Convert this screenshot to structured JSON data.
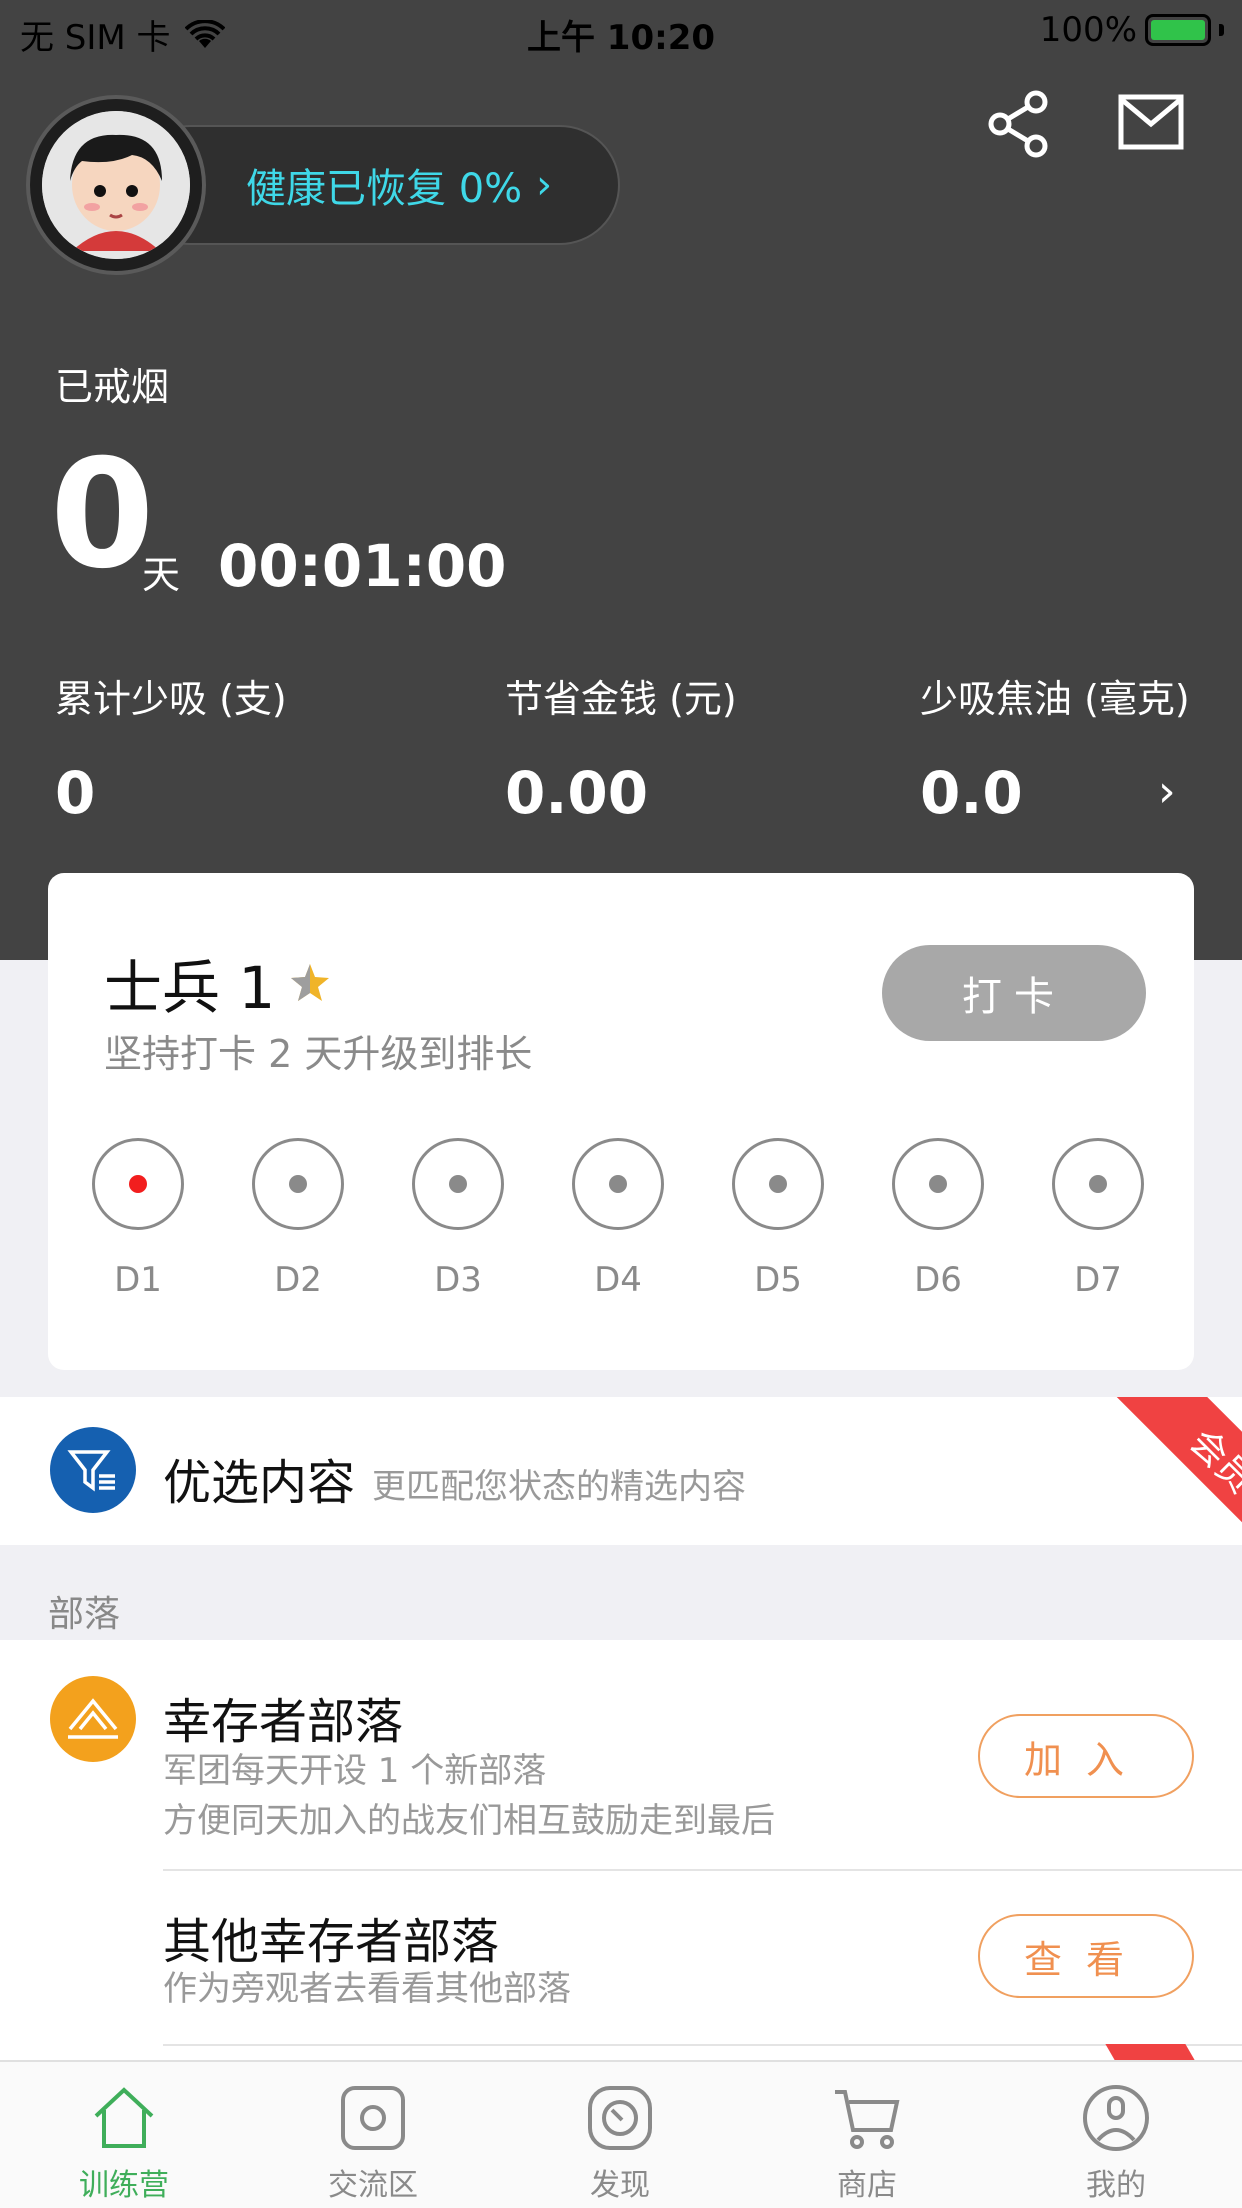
{
  "status_bar": {
    "carrier": "无 SIM 卡",
    "time": "上午 10:20",
    "battery": "100%"
  },
  "header": {
    "health_text": "健康已恢复 0%",
    "health_chevron": "›",
    "icons": [
      "share-icon",
      "mail-icon"
    ]
  },
  "quit": {
    "label": "已戒烟",
    "days": "0",
    "days_unit": "天",
    "timer": "00:01:00"
  },
  "stats": [
    {
      "label": "累计少吸 (支)",
      "value": "0"
    },
    {
      "label": "节省金钱 (元)",
      "value": "0.00"
    },
    {
      "label": "少吸焦油 (毫克)",
      "value": "0.0"
    }
  ],
  "rank": {
    "title": "士兵 1",
    "subtitle": "坚持打卡 2 天升级到排长",
    "checkin_label": "打卡",
    "days": [
      "D1",
      "D2",
      "D3",
      "D4",
      "D5",
      "D6",
      "D7"
    ],
    "active_day_index": 0
  },
  "featured": {
    "title": "优选内容",
    "subtitle": "更匹配您状态的精选内容",
    "badge": "会员"
  },
  "section": {
    "label": "部落"
  },
  "tribes": [
    {
      "title": "幸存者部落",
      "desc_line1": "军团每天开设 1 个新部落",
      "desc_line2": "方便同天加入的战友们相互鼓励走到最后",
      "button": "加入"
    },
    {
      "title": "其他幸存者部落",
      "desc_line1": "作为旁观者去看看其他部落",
      "button": "查看"
    }
  ],
  "tabbar": {
    "items": [
      {
        "label": "训练营",
        "icon": "home-icon",
        "active": true
      },
      {
        "label": "交流区",
        "icon": "chat-icon",
        "active": false
      },
      {
        "label": "发现",
        "icon": "compass-icon",
        "active": false
      },
      {
        "label": "商店",
        "icon": "cart-icon",
        "active": false
      },
      {
        "label": "我的",
        "icon": "user-icon",
        "active": false
      }
    ]
  },
  "colors": {
    "header_bg": "#434343",
    "accent_cyan": "#3fd8e8",
    "active_green": "#3fae5a",
    "orange": "#f09050",
    "red": "#f21e1e"
  }
}
